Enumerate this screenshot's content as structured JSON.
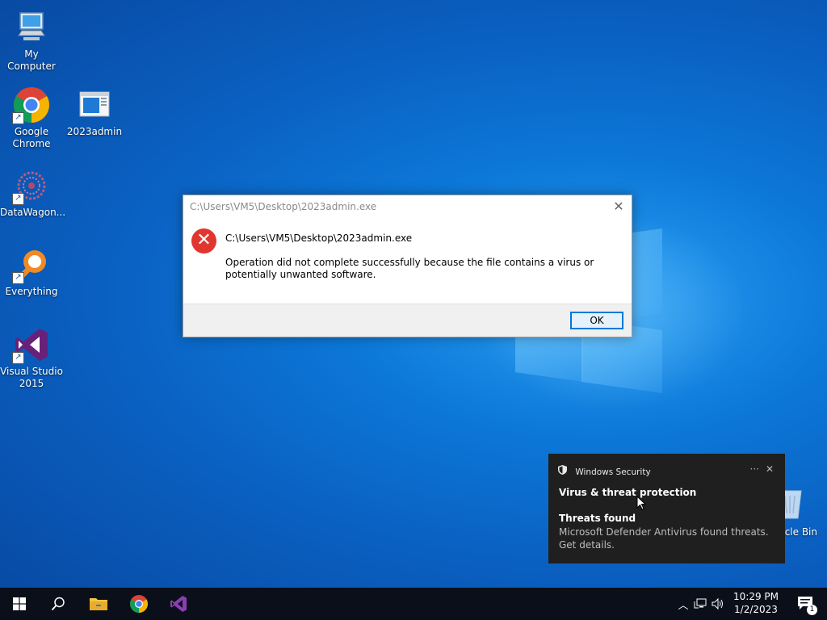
{
  "desktop": {
    "icons": [
      {
        "label": "My Computer",
        "icon": "computer-icon"
      },
      {
        "label": "Google Chrome",
        "icon": "chrome-icon"
      },
      {
        "label": "2023admin",
        "icon": "exe-window-icon"
      },
      {
        "label": "DataWagon...",
        "icon": "datawagon-icon"
      },
      {
        "label": "Everything",
        "icon": "everything-search-icon"
      },
      {
        "label": "Visual Studio 2015",
        "icon": "visual-studio-icon"
      }
    ],
    "recycle_bin_label": "cle Bin"
  },
  "dialog": {
    "title": "C:\\Users\\VM5\\Desktop\\2023admin.exe",
    "heading": "C:\\Users\\VM5\\Desktop\\2023admin.exe",
    "message": "Operation did not complete successfully because the file contains a virus or potentially unwanted software.",
    "ok_label": "OK",
    "close_glyph": "✕"
  },
  "toast": {
    "app_name": "Windows Security",
    "more_glyph": "···",
    "close_glyph": "✕",
    "title": "Virus & threat protection",
    "subtitle": "Threats found",
    "body": "Microsoft Defender Antivirus found threats. Get details."
  },
  "taskbar": {
    "time": "10:29 PM",
    "date": "1/2/2023",
    "notification_count": "1"
  },
  "colors": {
    "error_red": "#e0362f",
    "accent_blue": "#0078d7",
    "toast_bg": "#1f1f1f",
    "taskbar_bg": "#0b0f1a"
  }
}
